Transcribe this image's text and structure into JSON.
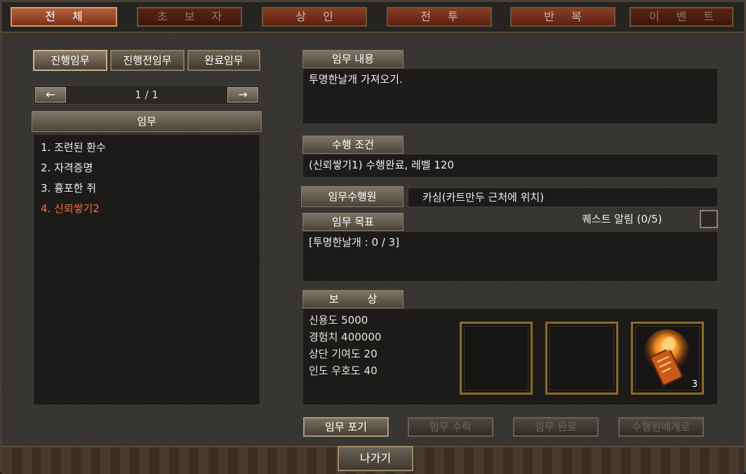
{
  "top_tabs": [
    {
      "label": "전체"
    },
    {
      "label": "초보자"
    },
    {
      "label": "상인"
    },
    {
      "label": "전투"
    },
    {
      "label": "반복"
    },
    {
      "label": "이벤트"
    }
  ],
  "subtabs": [
    {
      "label": "진행임무"
    },
    {
      "label": "진행전임무"
    },
    {
      "label": "완료임무"
    }
  ],
  "pager": {
    "prev": "←",
    "next": "→",
    "text": "1 / 1"
  },
  "quest_list": {
    "header": "임무",
    "items": [
      {
        "label": "1. 조련된 환수"
      },
      {
        "label": "2. 자격증명"
      },
      {
        "label": "3. 흉포한 쥐"
      },
      {
        "label": "4. 신뢰쌓기2"
      }
    ],
    "selected_index": 3,
    "selected_color": "#ff6a2a"
  },
  "details": {
    "content_header": "임무 내용",
    "content_text": "투명한날개 가져오기.",
    "condition_header": "수행 조건",
    "condition_text": "(신뢰쌓기1) 수행완료, 레벨 120",
    "npc_header": "임무수행원",
    "npc_text": "카심(카트만두 근처에 위치)",
    "goal_header": "임무 목표",
    "quest_alert": "퀘스트 알림 (0/5)",
    "goal_text": "[투명한날개 : 0 / 3]",
    "reward_header": "보 상",
    "rewards": [
      {
        "label": "신용도 5000"
      },
      {
        "label": "경험치 400000"
      },
      {
        "label": "상단 기여도 20"
      },
      {
        "label": "인도 우호도 40"
      }
    ],
    "reward_item_count": "3"
  },
  "actions": {
    "abandon": "임무 포기",
    "accept": "임무 수락",
    "complete": "임무 완료",
    "to_npc": "수행원에게로"
  },
  "exit_label": "나가기"
}
